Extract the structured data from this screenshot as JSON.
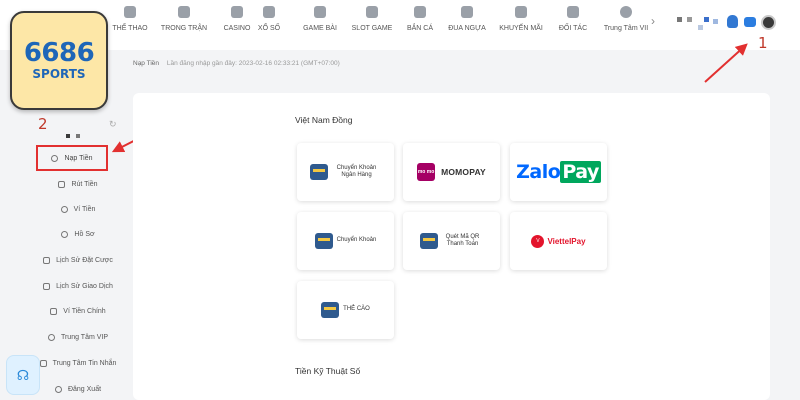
{
  "brand": {
    "logo_number": "6686",
    "logo_sub": "SPORTS"
  },
  "topnav": {
    "items": [
      {
        "label": "THỂ THAO",
        "icon": "soccer-ball-icon"
      },
      {
        "label": "TRONG TRẬN",
        "icon": "video-icon"
      },
      {
        "label": "CASINO",
        "icon": "cards-icon"
      },
      {
        "label": "XỔ SỐ",
        "icon": "lottery-ball-icon"
      },
      {
        "label": "GAME BÀI",
        "icon": "game-cards-icon"
      },
      {
        "label": "SLOT GAME",
        "icon": "slot-machine-icon"
      },
      {
        "label": "BẮN CÁ",
        "icon": "fish-icon"
      },
      {
        "label": "ĐUA NGỰA",
        "icon": "horse-icon"
      },
      {
        "label": "KHUYẾN MÃI",
        "icon": "percent-icon"
      },
      {
        "label": "ĐỐI TÁC",
        "icon": "partner-icon"
      },
      {
        "label": "Trung Tâm VII",
        "icon": "person-icon"
      }
    ],
    "chevron": "›"
  },
  "breadcrumb": {
    "current": "Nạp Tiền",
    "last_login": "Lần đăng nhập gần đây: 2023-02-16 02:33:21 (GMT+07:00)"
  },
  "annotations": {
    "step1": "1",
    "step2": "2"
  },
  "sidebar": {
    "items": [
      {
        "label": "Nạp Tiền",
        "icon": "deposit-icon",
        "active": true
      },
      {
        "label": "Rút Tiền",
        "icon": "withdraw-icon"
      },
      {
        "label": "Ví Tiền",
        "icon": "wallet-icon"
      },
      {
        "label": "Hồ Sơ",
        "icon": "profile-icon"
      },
      {
        "label": "Lịch Sử Đặt Cược",
        "icon": "bet-history-icon"
      },
      {
        "label": "Lịch Sử Giao Dịch",
        "icon": "transaction-history-icon"
      },
      {
        "label": "Ví Tiền Chính",
        "icon": "main-wallet-icon"
      },
      {
        "label": "Trung Tâm VIP",
        "icon": "vip-icon"
      },
      {
        "label": "Trung Tâm Tin Nhắn",
        "icon": "message-icon"
      },
      {
        "label": "Đăng Xuất",
        "icon": "logout-icon"
      }
    ]
  },
  "deposit": {
    "vnd_title": "Việt Nam Đồng",
    "methods": [
      {
        "label": "Chuyển Khoản Ngân Hàng",
        "icon": "bank-card-icon"
      },
      {
        "label": "MOMOPAY",
        "icon": "momo-logo",
        "logo_text": "mo mo"
      },
      {
        "label": "ZaloPay",
        "logo_zalo": "Zalo",
        "logo_pay": "Pay"
      },
      {
        "label": "Chuyển Khoản",
        "icon": "bank-card-icon"
      },
      {
        "label": "Quét Mã QR Thanh Toán",
        "icon": "qr-scan-icon"
      },
      {
        "label": "ViettelPay",
        "icon": "viettel-logo"
      },
      {
        "label": "THẺ CÀO",
        "icon": "scratch-card-icon"
      }
    ],
    "crypto_title": "Tiền Kỹ Thuật Số"
  },
  "colors": {
    "accent_red": "#e23030",
    "brand_blue": "#1e66b8",
    "logo_bg": "#fde7a7"
  }
}
